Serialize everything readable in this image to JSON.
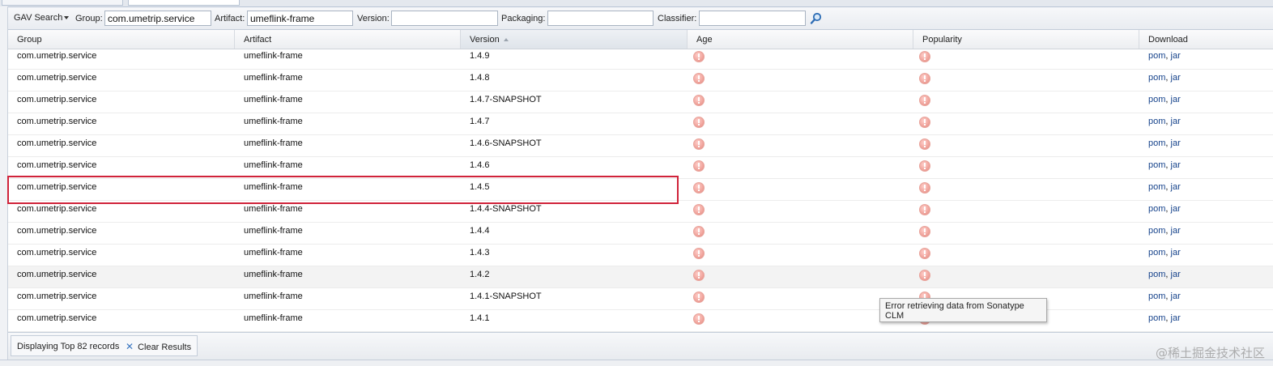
{
  "toolbar": {
    "search_mode": "GAV Search",
    "group_label": "Group:",
    "group_value": "com.umetrip.service",
    "artifact_label": "Artifact:",
    "artifact_value": "umeflink-frame",
    "version_label": "Version:",
    "version_value": "",
    "packaging_label": "Packaging:",
    "packaging_value": "",
    "classifier_label": "Classifier:",
    "classifier_value": "",
    "search_icon": "magnifier-icon"
  },
  "grid": {
    "columns": [
      "Group",
      "Artifact",
      "Version",
      "Age",
      "Popularity",
      "Download"
    ],
    "sorted_column": "Version",
    "sort_direction": "ascending",
    "rows": [
      {
        "group": "com.umetrip.service",
        "artifact": "umeflink-frame",
        "version": "1.4.9",
        "pom": "pom",
        "jar": "jar"
      },
      {
        "group": "com.umetrip.service",
        "artifact": "umeflink-frame",
        "version": "1.4.8",
        "pom": "pom",
        "jar": "jar"
      },
      {
        "group": "com.umetrip.service",
        "artifact": "umeflink-frame",
        "version": "1.4.7-SNAPSHOT",
        "pom": "pom",
        "jar": "jar"
      },
      {
        "group": "com.umetrip.service",
        "artifact": "umeflink-frame",
        "version": "1.4.7",
        "pom": "pom",
        "jar": "jar"
      },
      {
        "group": "com.umetrip.service",
        "artifact": "umeflink-frame",
        "version": "1.4.6-SNAPSHOT",
        "pom": "pom",
        "jar": "jar"
      },
      {
        "group": "com.umetrip.service",
        "artifact": "umeflink-frame",
        "version": "1.4.6",
        "pom": "pom",
        "jar": "jar"
      },
      {
        "group": "com.umetrip.service",
        "artifact": "umeflink-frame",
        "version": "1.4.5",
        "pom": "pom",
        "jar": "jar"
      },
      {
        "group": "com.umetrip.service",
        "artifact": "umeflink-frame",
        "version": "1.4.4-SNAPSHOT",
        "pom": "pom",
        "jar": "jar"
      },
      {
        "group": "com.umetrip.service",
        "artifact": "umeflink-frame",
        "version": "1.4.4",
        "pom": "pom",
        "jar": "jar"
      },
      {
        "group": "com.umetrip.service",
        "artifact": "umeflink-frame",
        "version": "1.4.3",
        "pom": "pom",
        "jar": "jar"
      },
      {
        "group": "com.umetrip.service",
        "artifact": "umeflink-frame",
        "version": "1.4.2",
        "pom": "pom",
        "jar": "jar"
      },
      {
        "group": "com.umetrip.service",
        "artifact": "umeflink-frame",
        "version": "1.4.1-SNAPSHOT",
        "pom": "pom",
        "jar": "jar"
      },
      {
        "group": "com.umetrip.service",
        "artifact": "umeflink-frame",
        "version": "1.4.1",
        "pom": "pom",
        "jar": "jar"
      }
    ],
    "highlighted_row_version": "1.4.5",
    "hovered_row_version": "1.4.2",
    "status_icon": "error-icon",
    "separator": ","
  },
  "tooltip": {
    "text": "Error retrieving data from Sonatype CLM"
  },
  "status": {
    "text": "Displaying Top 82 records",
    "clear_label": "Clear Results",
    "clear_icon": "close-icon"
  },
  "watermark": "@稀土掘金技术社区",
  "colors": {
    "highlight_border": "#d0233a",
    "link": "#15428b",
    "error_icon": "#f0a49c"
  }
}
